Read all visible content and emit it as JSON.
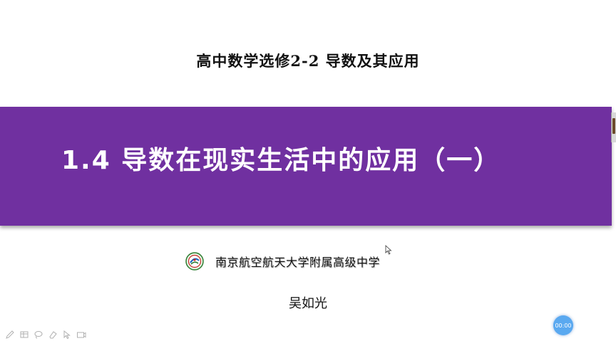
{
  "slide": {
    "subtitle": "高中数学选修2-2 导数及其应用",
    "title": "1.4 导数在现实生活中的应用（一）",
    "school_name": "南京航空航天大学附属高级中学",
    "author": "吴如光",
    "band_color": "#7030a0"
  },
  "player": {
    "timer": "00:00",
    "tools": [
      "pen-icon",
      "table-icon",
      "lasso-icon",
      "eraser-icon",
      "pointer-icon",
      "camera-icon"
    ]
  }
}
